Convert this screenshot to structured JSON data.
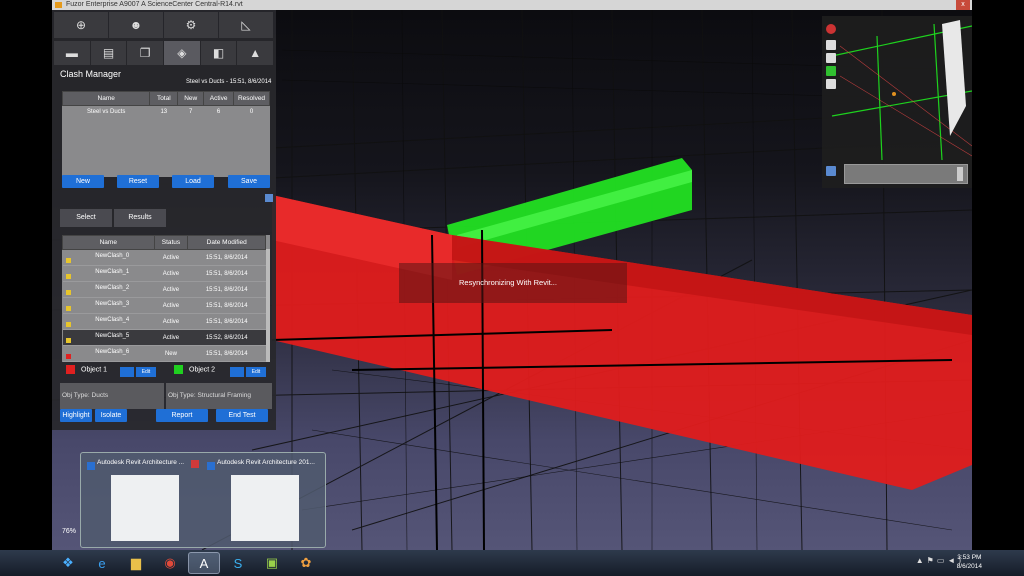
{
  "window": {
    "title": "Fuzor Enterprise  A9007 A ScienceCenter Central-R14.rvt",
    "close": "x"
  },
  "panel": {
    "title": "Clash Manager",
    "test_meta": "Steel vs Ducts - 15:51, 8/6/2014",
    "summary": {
      "headers": [
        "Name",
        "Total",
        "New",
        "Active",
        "Resolved"
      ],
      "rows": [
        {
          "name": "Steel vs Ducts",
          "total": "13",
          "new": "7",
          "active": "6",
          "resolved": "0"
        }
      ]
    },
    "buttons": {
      "new": "New",
      "reset": "Reset",
      "load": "Load",
      "save": "Save"
    },
    "tabs": {
      "select": "Select",
      "results": "Results"
    },
    "clash_list": {
      "headers": [
        "Name",
        "Status",
        "Date Modified"
      ],
      "rows": [
        {
          "name": "NewClash_0",
          "status": "Active",
          "date": "15:51, 8/6/2014"
        },
        {
          "name": "NewClash_1",
          "status": "Active",
          "date": "15:51, 8/6/2014"
        },
        {
          "name": "NewClash_2",
          "status": "Active",
          "date": "15:51, 8/6/2014"
        },
        {
          "name": "NewClash_3",
          "status": "Active",
          "date": "15:51, 8/6/2014"
        },
        {
          "name": "NewClash_4",
          "status": "Active",
          "date": "15:51, 8/6/2014"
        },
        {
          "name": "NewClash_5",
          "status": "Active",
          "date": "15:52, 8/6/2014"
        },
        {
          "name": "NewClash_6",
          "status": "New",
          "date": "15:51, 8/6/2014"
        }
      ]
    },
    "object1": {
      "label": "Object 1",
      "color": "#e02020",
      "edit": "Edit",
      "type": "Obj Type: Ducts"
    },
    "object2": {
      "label": "Object 2",
      "color": "#20d020",
      "edit": "Edit",
      "type": "Obj Type: Structural Framing"
    },
    "bottom_buttons": {
      "highlight": "Highlight",
      "isolate": "Isolate",
      "report": "Report",
      "end_test": "End Test"
    }
  },
  "overlay": {
    "message": "Resynchronizing With Revit..."
  },
  "thumbnails": [
    {
      "title": "Autodesk Revit Architecture ..."
    },
    {
      "title": "Autodesk Revit Architecture 201..."
    }
  ],
  "zoom_percent": "76%",
  "clock": {
    "time": "3:53 PM",
    "date": "8/6/2014"
  },
  "colors": {
    "duct": "#e02020",
    "framing": "#20e020",
    "accent": "#1f6fd6"
  }
}
